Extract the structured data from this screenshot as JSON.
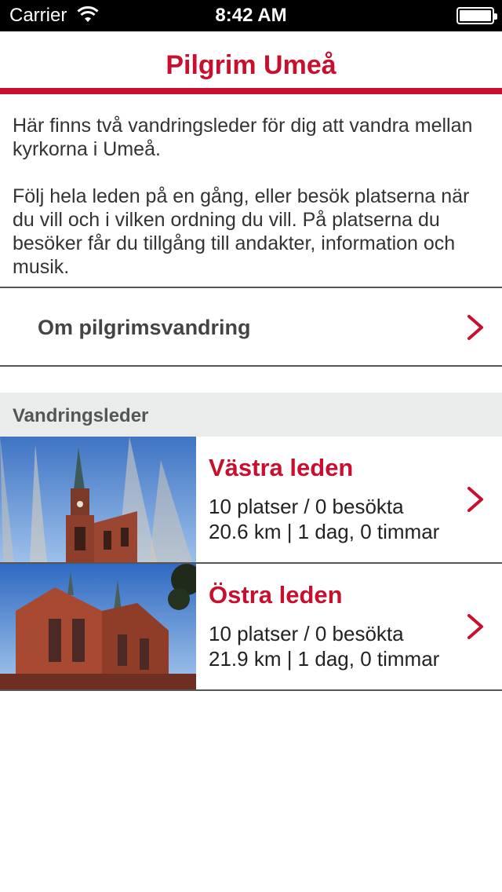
{
  "status_bar": {
    "carrier": "Carrier",
    "time": "8:42 AM",
    "icons": [
      "wifi-icon",
      "battery-icon"
    ]
  },
  "nav": {
    "title": "Pilgrim Umeå"
  },
  "intro": {
    "paragraph1": "Här finns två vandringsleder för dig att vandra mellan kyrkorna i Umeå.",
    "paragraph2": "Följ hela leden på en gång, eller besök platserna när du vill och i vilken ordning du vill. På platserna du besöker får du tillgång till andakter, information och musik."
  },
  "about": {
    "label": "Om pilgrimsvandring"
  },
  "section": {
    "title": "Vandringsleder"
  },
  "routes": [
    {
      "name": "Västra leden",
      "places": "10 platser / 0 besökta",
      "distance": "20.6 km | 1 dag, 0 timmar"
    },
    {
      "name": "Östra leden",
      "places": "10 platser / 0 besökta",
      "distance": "21.9 km | 1 dag, 0 timmar"
    }
  ],
  "colors": {
    "accent": "#c8102e",
    "section_bg": "#eaecec",
    "status_bar_bg": "#000000"
  }
}
